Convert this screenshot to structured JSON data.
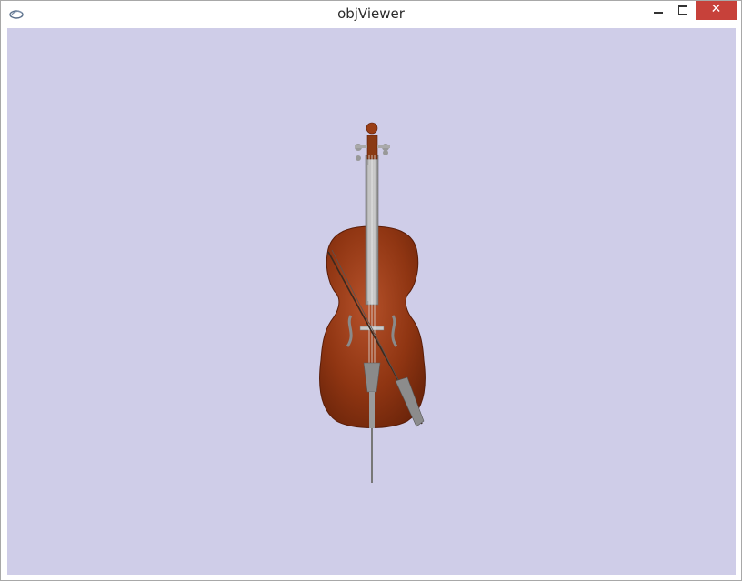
{
  "window": {
    "title": "objViewer",
    "controls": {
      "minimize": "minimize",
      "maximize": "maximize",
      "close": "✕"
    }
  },
  "viewport": {
    "background": "#cfcde8",
    "model": "cello-with-bow"
  },
  "colors": {
    "body": "#8a2e10",
    "body_highlight": "#b5512a",
    "metal": "#9a9a9a",
    "bow_stick": "#3a2a20",
    "close_button": "#c7413a"
  }
}
